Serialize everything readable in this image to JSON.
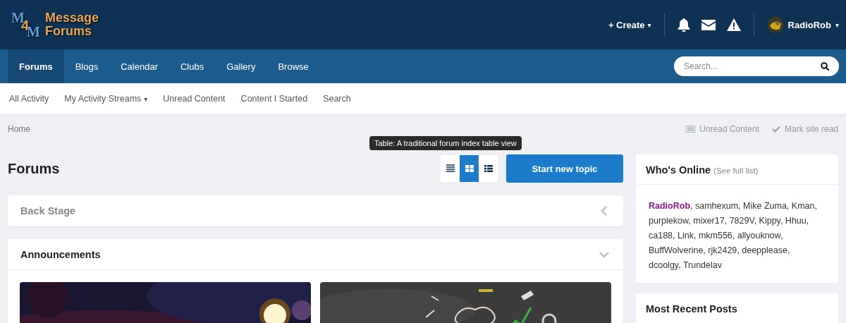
{
  "logo": {
    "letters": [
      "M",
      "4",
      "M"
    ],
    "title_lines": [
      "Message",
      "Forums"
    ]
  },
  "user_bar": {
    "create": "+ Create",
    "caret": "▾",
    "user": "RadioRob"
  },
  "nav": [
    {
      "label": "Forums",
      "selected": true
    },
    {
      "label": "Blogs",
      "selected": false
    },
    {
      "label": "Calendar",
      "selected": false
    },
    {
      "label": "Clubs",
      "selected": false
    },
    {
      "label": "Gallery",
      "selected": false
    },
    {
      "label": "Browse",
      "selected": false
    }
  ],
  "search": {
    "placeholder": "Search..."
  },
  "subnav": [
    {
      "label": "All Activity",
      "dropdown": false
    },
    {
      "label": "My Activity Streams",
      "dropdown": true
    },
    {
      "label": "Unread Content",
      "dropdown": false
    },
    {
      "label": "Content I Started",
      "dropdown": false
    },
    {
      "label": "Search",
      "dropdown": false
    }
  ],
  "breadcrumb": "Home",
  "page_actions": [
    "Unread Content",
    "Mark site read"
  ],
  "page_title": "Forums",
  "tooltip": "Table: A traditional forum index table view",
  "view_modes": [
    {
      "kind": "table",
      "selected": false
    },
    {
      "kind": "grid",
      "selected": true
    },
    {
      "kind": "fluid",
      "selected": false
    }
  ],
  "start_button": "Start new topic",
  "categories": [
    {
      "title": "Back Stage",
      "expanded": false,
      "muted": true
    },
    {
      "title": "Announcements",
      "expanded": true,
      "muted": false
    }
  ],
  "sidebar": [
    {
      "title": "Who's Online",
      "link": "(See full list)",
      "body": "**RadioRob**, samhexum, Mike Zuma, Kman, purplekow, mixer17, 7829V, Kippy, Hhuu, ca188, Link, mkm556, allyouknow, BuffWolverine, rjk2429, deepplease, dcoolgy, Trundelav"
    },
    {
      "title": "Most Recent Posts"
    }
  ]
}
